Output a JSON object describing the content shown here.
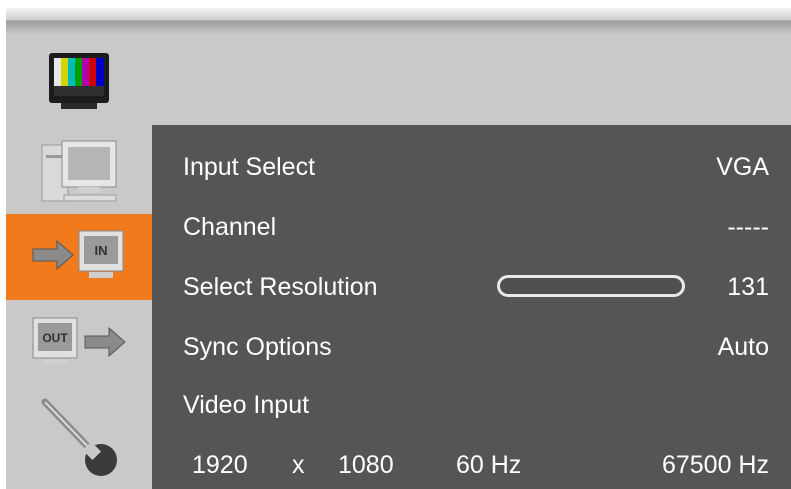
{
  "menu": {
    "input_select": {
      "label": "Input Select",
      "value": "VGA"
    },
    "channel": {
      "label": "Channel",
      "value": "-----"
    },
    "select_resolution": {
      "label": "Select Resolution",
      "value": "131"
    },
    "sync_options": {
      "label": "Sync Options",
      "value": "Auto"
    },
    "video_input": {
      "label": "Video Input"
    }
  },
  "status": {
    "width": "1920",
    "times": "x",
    "height": "1080",
    "vfreq": "60 Hz",
    "hfreq": "67500 Hz"
  },
  "sidebar": {
    "items": [
      {
        "icon": "color-bars-tv-icon"
      },
      {
        "icon": "computer-monitor-icon"
      },
      {
        "icon": "input-in-icon",
        "active": true
      },
      {
        "icon": "output-out-icon"
      },
      {
        "icon": "wrench-icon"
      }
    ]
  },
  "colors": {
    "active": "#f07a1c",
    "panel": "#555555",
    "background": "#c9c9c9",
    "text": "#ffffff"
  }
}
